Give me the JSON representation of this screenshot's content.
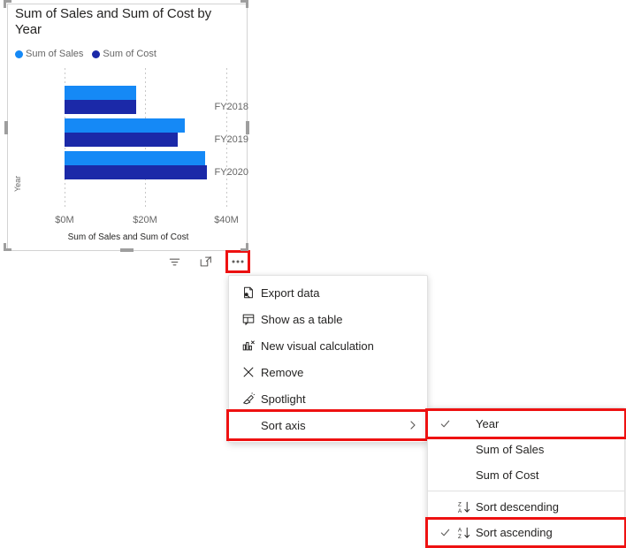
{
  "visual": {
    "title": "Sum of Sales and Sum of Cost by Year",
    "y_axis_title": "Year",
    "x_axis_title": "Sum of Sales and Sum of Cost",
    "legend": [
      {
        "label": "Sum of Sales",
        "color": "#1589F6",
        "icon": "legend-dot-sales"
      },
      {
        "label": "Sum of Cost",
        "color": "#1B29A8",
        "icon": "legend-dot-cost"
      }
    ]
  },
  "chart_data": {
    "type": "bar",
    "orientation": "horizontal",
    "title": "Sum of Sales and Sum of Cost by Year",
    "xlabel": "Sum of Sales and Sum of Cost",
    "ylabel": "Year",
    "categories": [
      "FY2018",
      "FY2019",
      "FY2020"
    ],
    "xticks": [
      "$0M",
      "$20M",
      "$40M"
    ],
    "xtick_values": [
      0,
      20,
      40
    ],
    "xlim": [
      0,
      44
    ],
    "grid": true,
    "legend_position": "top-left",
    "series": [
      {
        "name": "Sum of Sales",
        "color": "#1589F6",
        "values": [
          17.7,
          29.7,
          34.8
        ]
      },
      {
        "name": "Sum of Cost",
        "color": "#1B29A8",
        "values": [
          17.7,
          28.0,
          35.2
        ]
      }
    ]
  },
  "toolbar": {
    "filter_label": "filter-icon",
    "focus_label": "focus-mode-icon",
    "more_label": "more-options-icon"
  },
  "context_menu": {
    "items": [
      {
        "label": "Export data",
        "icon": "export-data-icon",
        "submenu": false,
        "highlighted": false
      },
      {
        "label": "Show as a table",
        "icon": "show-as-table-icon",
        "submenu": false,
        "highlighted": false
      },
      {
        "label": "New visual calculation",
        "icon": "new-visual-calculation-icon",
        "submenu": false,
        "highlighted": false
      },
      {
        "label": "Remove",
        "icon": "remove-icon",
        "submenu": false,
        "highlighted": false
      },
      {
        "label": "Spotlight",
        "icon": "spotlight-icon",
        "submenu": false,
        "highlighted": false
      },
      {
        "label": "Sort axis",
        "icon": "none",
        "submenu": true,
        "highlighted": true
      }
    ]
  },
  "sort_submenu": {
    "items": [
      {
        "label": "Year",
        "checked": true,
        "icon": "none",
        "highlighted": true
      },
      {
        "label": "Sum of Sales",
        "checked": false,
        "icon": "none",
        "highlighted": false
      },
      {
        "label": "Sum of Cost",
        "checked": false,
        "icon": "none",
        "highlighted": false
      },
      {
        "label": "Sort descending",
        "checked": false,
        "icon": "sort-descending-icon",
        "highlighted": false
      },
      {
        "label": "Sort ascending",
        "checked": true,
        "icon": "sort-ascending-icon",
        "highlighted": true
      }
    ]
  },
  "colors": {
    "sales": "#1589F6",
    "cost": "#1B29A8",
    "highlight": "#ee1111",
    "text": "#252423",
    "muted": "#666666"
  }
}
